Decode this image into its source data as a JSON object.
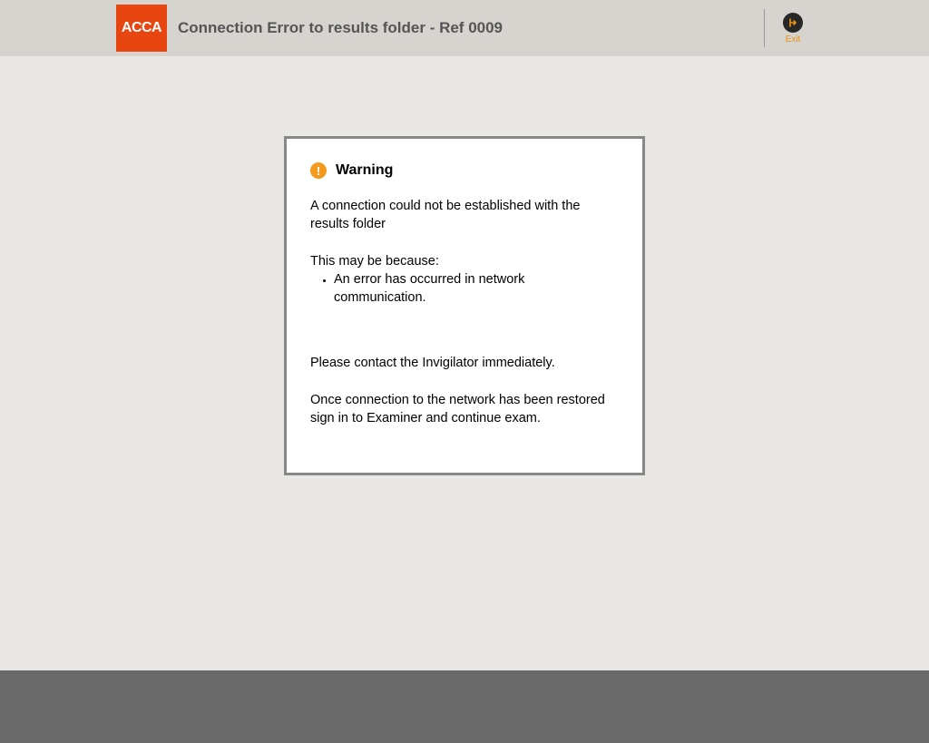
{
  "header": {
    "logo_text": "ACCA",
    "title": "Connection Error to results folder - Ref 0009",
    "exit_label": "Exit"
  },
  "dialog": {
    "title": "Warning",
    "para1": "A connection could not be established with the results folder",
    "para2": "This may be because:",
    "bullet1": "An error has occurred in network communication.",
    "para3": "Please contact the Invigilator immediately.",
    "para4": "Once connection to the network has been restored sign in to Examiner and continue exam."
  }
}
